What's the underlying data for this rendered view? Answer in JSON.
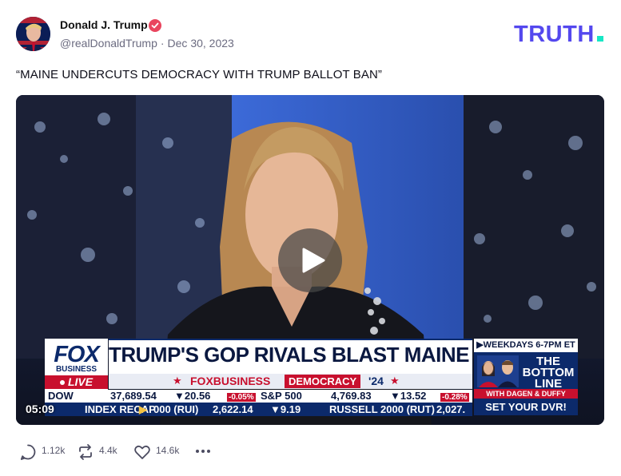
{
  "post": {
    "author_name": "Donald J. Trump",
    "author_handle": "@realDonaldTrump",
    "date": "Dec 30, 2023",
    "separator": "·",
    "text": "“MAINE UNDERCUTS DEMOCRACY WITH TRUMP BALLOT BAN”",
    "brand": "TRUTH."
  },
  "video": {
    "duration": "05:09",
    "chyron": {
      "logo_top": "FOX",
      "logo_bottom": "BUSINESS",
      "live": "LIVE",
      "headline": "TRUMP'S GOP RIVALS BLAST MAINE DECISION",
      "sub_brand": "FOXBUSINESS",
      "sub_tag": "DEMOCRACY",
      "sub_year": "'24",
      "ticker_line1": [
        {
          "label": "DOW",
          "value": "37,689.54",
          "change": "▼20.56",
          "pct": "-0.05%"
        },
        {
          "label": "S&P 500",
          "value": "4,769.83",
          "change": "▼13.52",
          "pct": "-0.28%"
        }
      ],
      "ticker_line2": [
        {
          "label": "INDEX RECAP",
          "arrow": "▶"
        },
        {
          "label": "000 (RUI)",
          "value": "2,622.14",
          "change": "▼9.19"
        },
        {
          "label": "RUSSELL 2000 (RUT)",
          "value": "2,027."
        }
      ],
      "promo_top": "▶WEEKDAYS 6-7PM ET",
      "promo_title": "THE BOTTOM LINE",
      "promo_with": "WITH DAGEN & DUFFY",
      "promo_dvr": "SET YOUR DVR!"
    }
  },
  "actions": {
    "replies": "1.12k",
    "retruths": "4.4k",
    "likes": "14.6k",
    "more": "•••"
  },
  "colors": {
    "brand_purple": "#5448ee",
    "brand_teal": "#17e7c5",
    "verified": "#e9455e",
    "fox_navy": "#0c2a6b",
    "fox_red": "#c8102e"
  },
  "icons": [
    "verified-icon",
    "play-icon",
    "reply-icon",
    "retruth-icon",
    "like-icon",
    "more-icon"
  ]
}
